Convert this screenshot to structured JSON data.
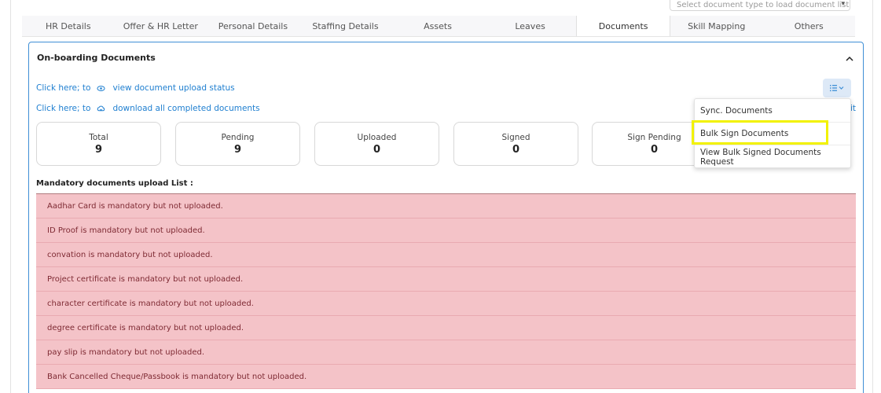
{
  "doc_type_select": {
    "placeholder": "Select document type to load document list"
  },
  "tabs": [
    {
      "label": "HR Details"
    },
    {
      "label": "Offer & HR Letter"
    },
    {
      "label": "Personal Details"
    },
    {
      "label": "Staffing Details"
    },
    {
      "label": "Assets"
    },
    {
      "label": "Leaves"
    },
    {
      "label": "Documents",
      "active": true
    },
    {
      "label": "Skill Mapping"
    },
    {
      "label": "Others"
    }
  ],
  "panel": {
    "title": "On-boarding Documents",
    "links": [
      {
        "prefix": "Click here; to",
        "icon": "eye-icon",
        "label": "view document upload status"
      },
      {
        "prefix": "Click here; to",
        "icon": "cloud-download-icon",
        "label": "download all completed documents"
      }
    ],
    "edge_text": "it"
  },
  "stats": [
    {
      "label": "Total",
      "value": "9"
    },
    {
      "label": "Pending",
      "value": "9"
    },
    {
      "label": "Uploaded",
      "value": "0"
    },
    {
      "label": "Signed",
      "value": "0"
    },
    {
      "label": "Sign Pending",
      "value": "0"
    }
  ],
  "mandatory": {
    "title": "Mandatory documents upload List :",
    "items": [
      "Aadhar Card is mandatory but not uploaded.",
      "ID Proof is mandatory but not uploaded.",
      "convation is mandatory but not uploaded.",
      "Project certificate is mandatory but not uploaded.",
      "character certificate is mandatory but not uploaded.",
      "degree certificate is mandatory but not uploaded.",
      "pay slip is mandatory but not uploaded.",
      "Bank Cancelled Cheque/Passbook is mandatory but not uploaded."
    ]
  },
  "menu": {
    "items": [
      {
        "label": "Sync. Documents"
      },
      {
        "label": "Bulk Sign Documents",
        "highlighted": true
      },
      {
        "label": "View Bulk Signed Documents Request"
      }
    ]
  },
  "colors": {
    "accent": "#3f8fd6",
    "link": "#1f7fd0",
    "alert_bg": "#f4c3c8",
    "alert_text": "#7e2a33",
    "highlight": "#f2f200"
  }
}
